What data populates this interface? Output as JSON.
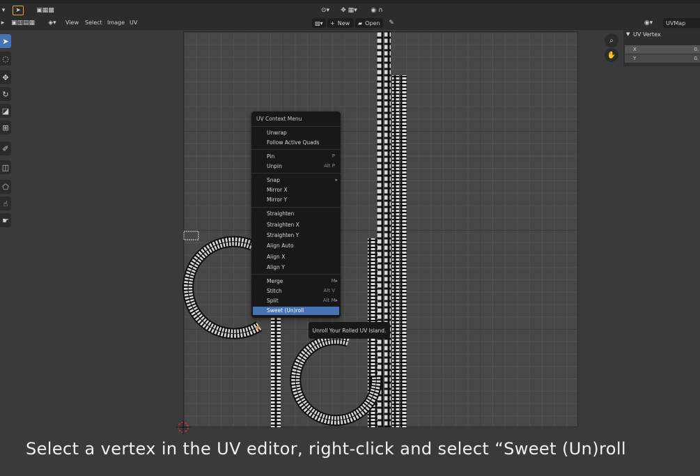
{
  "header": {
    "menus": [
      "View",
      "Select",
      "Image",
      "UV"
    ],
    "new_label": "New",
    "open_label": "Open",
    "uvmap_label": "UVMap"
  },
  "npanel": {
    "title": "UV Vertex",
    "x_label": "X",
    "x_value": "0.",
    "y_label": "Y",
    "y_value": "0."
  },
  "context_menu": {
    "title": "UV Context Menu",
    "items": [
      {
        "label": "Unwrap",
        "shortcut": ""
      },
      {
        "label": "Follow Active Quads",
        "shortcut": ""
      },
      {
        "label": "Pin",
        "shortcut": "P"
      },
      {
        "label": "Unpin",
        "shortcut": "Alt P"
      },
      {
        "label": "Snap",
        "shortcut": "▸"
      },
      {
        "label": "Mirror X",
        "shortcut": ""
      },
      {
        "label": "Mirror Y",
        "shortcut": ""
      },
      {
        "label": "Straighten",
        "shortcut": ""
      },
      {
        "label": "Straighten X",
        "shortcut": ""
      },
      {
        "label": "Straighten Y",
        "shortcut": ""
      },
      {
        "label": "Align Auto",
        "shortcut": ""
      },
      {
        "label": "Align X",
        "shortcut": ""
      },
      {
        "label": "Align Y",
        "shortcut": ""
      },
      {
        "label": "Merge",
        "shortcut": "M▸"
      },
      {
        "label": "Stitch",
        "shortcut": "Alt V"
      },
      {
        "label": "Split",
        "shortcut": "Alt M▸"
      },
      {
        "label": "Sweet (Un)roll",
        "shortcut": ""
      }
    ]
  },
  "tooltip": "Unroll Your Rolled UV Island.",
  "caption": "Select a vertex in the UV editor, right-click and select “Sweet (Un)roll",
  "colors": {
    "accent": "#4772b3",
    "background": "#3a3a3a",
    "menu_bg": "#181818"
  }
}
